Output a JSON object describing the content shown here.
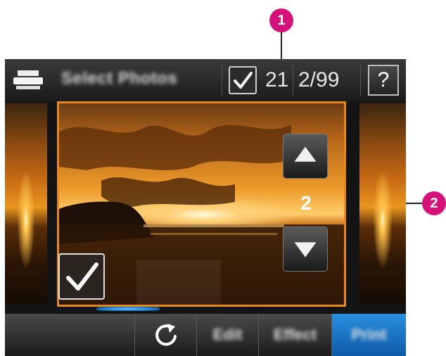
{
  "callouts": [
    {
      "number": "1"
    },
    {
      "number": "2"
    }
  ],
  "topbar": {
    "title": "Select Photos",
    "selected_count": "21",
    "photo_position": "2/99",
    "help_label": "?"
  },
  "copies": {
    "value": "2"
  },
  "bottombar": {
    "edit_label": "Edit",
    "effect_label": "Effect",
    "print_label": "Print"
  },
  "colors": {
    "accent_frame": "#e8871b",
    "callout": "#d4127a",
    "print_button": "#1a74c8"
  },
  "icons": [
    "printer-icon",
    "checkmark-icon",
    "help-icon",
    "arrow-up-icon",
    "arrow-down-icon",
    "rotate-icon"
  ]
}
